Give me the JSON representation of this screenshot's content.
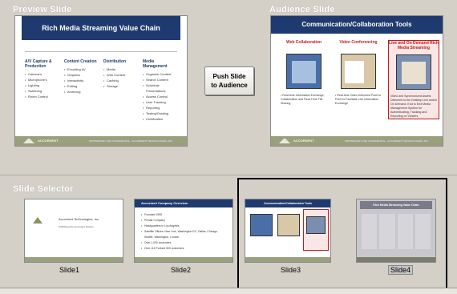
{
  "preview": {
    "pane_title": "Preview Slide",
    "slide_title": "Rich Media Streaming Value Chain",
    "columns": [
      {
        "heading": "A/V Capture & Production",
        "items": [
          "Camera's",
          "Microphone's",
          "Lighting",
          "Switching",
          "Room Control"
        ]
      },
      {
        "heading": "Content Creation",
        "items": [
          "Encoding AV",
          "Graphics",
          "Interactivity",
          "Editing",
          "Archiving"
        ]
      },
      {
        "heading": "Distribution",
        "items": [
          "Media",
          "Web Content",
          "Caching",
          "Storage"
        ]
      },
      {
        "heading": "Media Management",
        "items": [
          "Organize Content",
          "Search Content",
          "Schedule Presentations",
          "Access Control",
          "User Tracking",
          "Reporting",
          "Testing/Grading",
          "Certification"
        ]
      }
    ],
    "footer_logo": "ACCORDENT",
    "footer_copy": "PROPRIETARY AND CONFIDENTIAL - ACCORDENT TECHNOLOGIES, INC."
  },
  "audience": {
    "pane_title": "Audience Slide",
    "slide_title": "Communication/Collaboration Tools",
    "columns": [
      {
        "heading": "Web Collaboration",
        "desc": "• Real-time Information Exchange, Collaboration and Real-Time File Sharing"
      },
      {
        "heading": "Video Conferencing",
        "desc": "• Real-time Video Delivered Point to Point to Facilitate Live Information Exchange"
      },
      {
        "heading": "Live and On Demand Rich Media Streaming",
        "desc": "Video and Synchronized Assets Delivered to the Desktop Live and/or On Demand. End to End Media Management System for Authenticating, Tracking and Reporting on Viewers"
      }
    ]
  },
  "push_button": {
    "label_line1": "Push Slide",
    "label_line2": "to Audience"
  },
  "selector": {
    "pane_title": "Slide Selector",
    "slides": [
      {
        "label": "Slide1",
        "company": "Accordent Technologies, Inc.",
        "tagline": "Publishing the Accordent Stream"
      },
      {
        "label": "Slide2",
        "title": "Accordent Company Overview",
        "bullets": [
          "Founded 1995",
          "Private Company",
          "Headquarters in Los Angeles",
          "Satellite Offices: New York, Washington DC, Dallas, Chicago, Seattle, Washington, London",
          "Over 1,000 customers",
          "Over 115 Fortune 500 customers"
        ]
      },
      {
        "label": "Slide3",
        "title": "Communication/Collaboration Tools"
      },
      {
        "label": "Slide4",
        "title": "Rich Media Streaming Value Chain"
      }
    ],
    "selected": "Slide4"
  },
  "colors": {
    "title_bar": "#1f3a6e",
    "footer": "#9aa07e",
    "highlight": "#c21d1d"
  }
}
